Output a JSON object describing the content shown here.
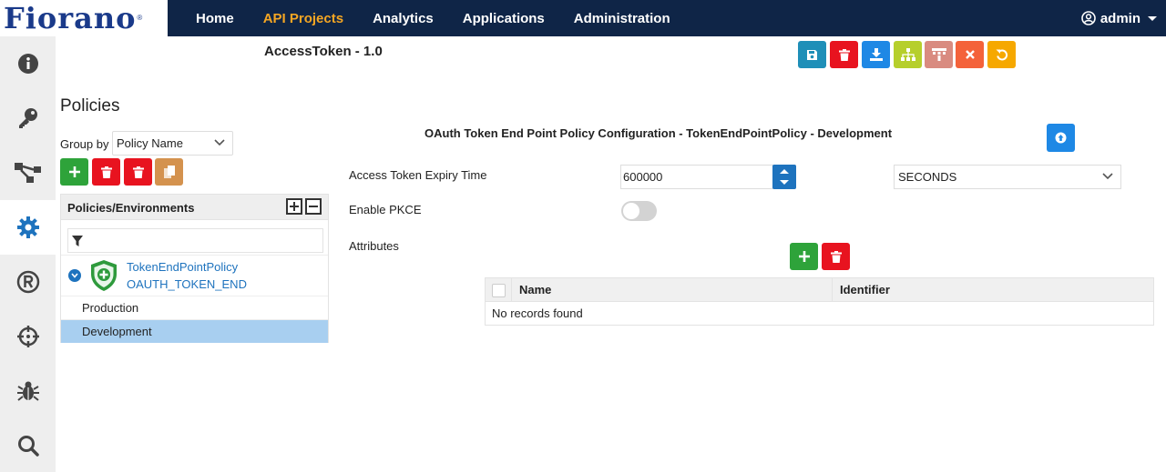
{
  "nav": {
    "logo": "Fiorano",
    "logo_mark": "®",
    "items": [
      "Home",
      "API Projects",
      "Analytics",
      "Applications",
      "Administration"
    ],
    "active": "API Projects",
    "user": "admin"
  },
  "sidebar": {
    "items": [
      "info-icon",
      "key-icon",
      "flow-icon",
      "gear-icon",
      "registered-icon",
      "crosshair-icon",
      "bug-icon",
      "search-icon"
    ],
    "active": "gear-icon"
  },
  "page": {
    "title": "AccessToken - 1.0"
  },
  "toolbar": {
    "buttons": [
      {
        "icon": "save-icon",
        "color": "#1f8fb8"
      },
      {
        "icon": "trash-icon",
        "color": "#e8131f"
      },
      {
        "icon": "download-icon",
        "color": "#1e88e5"
      },
      {
        "icon": "sitemap-icon",
        "color": "#b6cf2c"
      },
      {
        "icon": "hierarchy-icon",
        "color": "#d98b80"
      },
      {
        "icon": "close-icon",
        "color": "#f4623a"
      },
      {
        "icon": "undo-icon",
        "color": "#f6a800"
      }
    ]
  },
  "policies": {
    "heading": "Policies",
    "group_by_label": "Group by",
    "group_by_value": "Policy Name",
    "buttons": [
      {
        "icon": "plus-icon",
        "color": "#2ea33a"
      },
      {
        "icon": "trash-icon",
        "color": "#e8131f"
      },
      {
        "icon": "trash-icon",
        "color": "#e8131f"
      },
      {
        "icon": "copy-icon",
        "color": "#d4924e"
      }
    ],
    "tree": {
      "header": "Policies/Environments",
      "policy_name": "TokenEndPointPolicy",
      "policy_type": "OAUTH_TOKEN_END",
      "environments": [
        "Production",
        "Development"
      ],
      "selected": "Development"
    }
  },
  "config": {
    "title": "OAuth Token End Point Policy Configuration - TokenEndPointPolicy - Development",
    "expiry_label": "Access Token Expiry Time",
    "expiry_value": "600000",
    "expiry_unit": "SECONDS",
    "pkce_label": "Enable PKCE",
    "pkce_enabled": false,
    "attributes_label": "Attributes",
    "grid": {
      "columns": [
        "Name",
        "Identifier"
      ],
      "empty_text": "No records found"
    }
  }
}
